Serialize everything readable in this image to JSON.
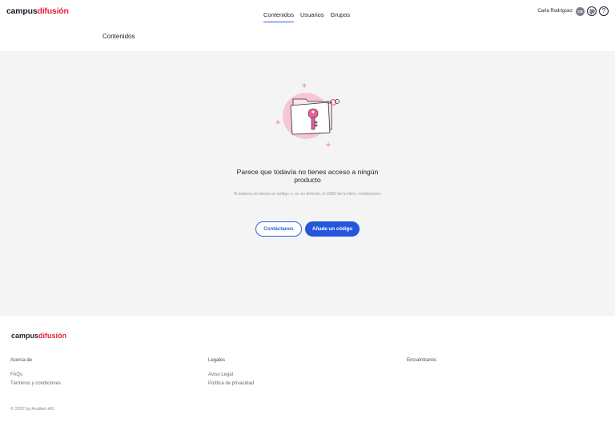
{
  "header": {
    "logo_part1": "campus",
    "logo_part2": "difusión",
    "tabs": [
      {
        "label": "Contenidos",
        "active": true
      },
      {
        "label": "Usuarios",
        "active": false
      },
      {
        "label": "Grupos",
        "active": false
      }
    ],
    "user_name": "Carla Rodríguez",
    "avatar_initials": "CR",
    "help_glyph": "?"
  },
  "subheader": {
    "title": "Contenidos"
  },
  "empty_state": {
    "illustration_icon": "folder-with-key",
    "title": "Parece que todavía no tienes acceso a ningún producto",
    "text": "Si todavía no tienes un código o, en su defecto, el ISBN de tu libro, contáctanos.",
    "secondary_button": "Contáctanos",
    "primary_button": "Añade un código"
  },
  "footer": {
    "logo_part1": "campus",
    "logo_part2": "difusión",
    "col1": {
      "heading": "Acerca de",
      "links": [
        "FAQs",
        "Términos y condiciones"
      ]
    },
    "col2": {
      "heading": "Legales",
      "links": [
        "Aviso Legal",
        "Política de privacidad"
      ]
    },
    "col3": {
      "heading": "Encuéntranos"
    },
    "copyright": "© 2022 by Avallain AG"
  },
  "colors": {
    "brand_red": "#e5203a",
    "accent_blue": "#2457dc",
    "illustration_pink": "#f6c6d6",
    "key_pink": "#ea5f9c"
  }
}
